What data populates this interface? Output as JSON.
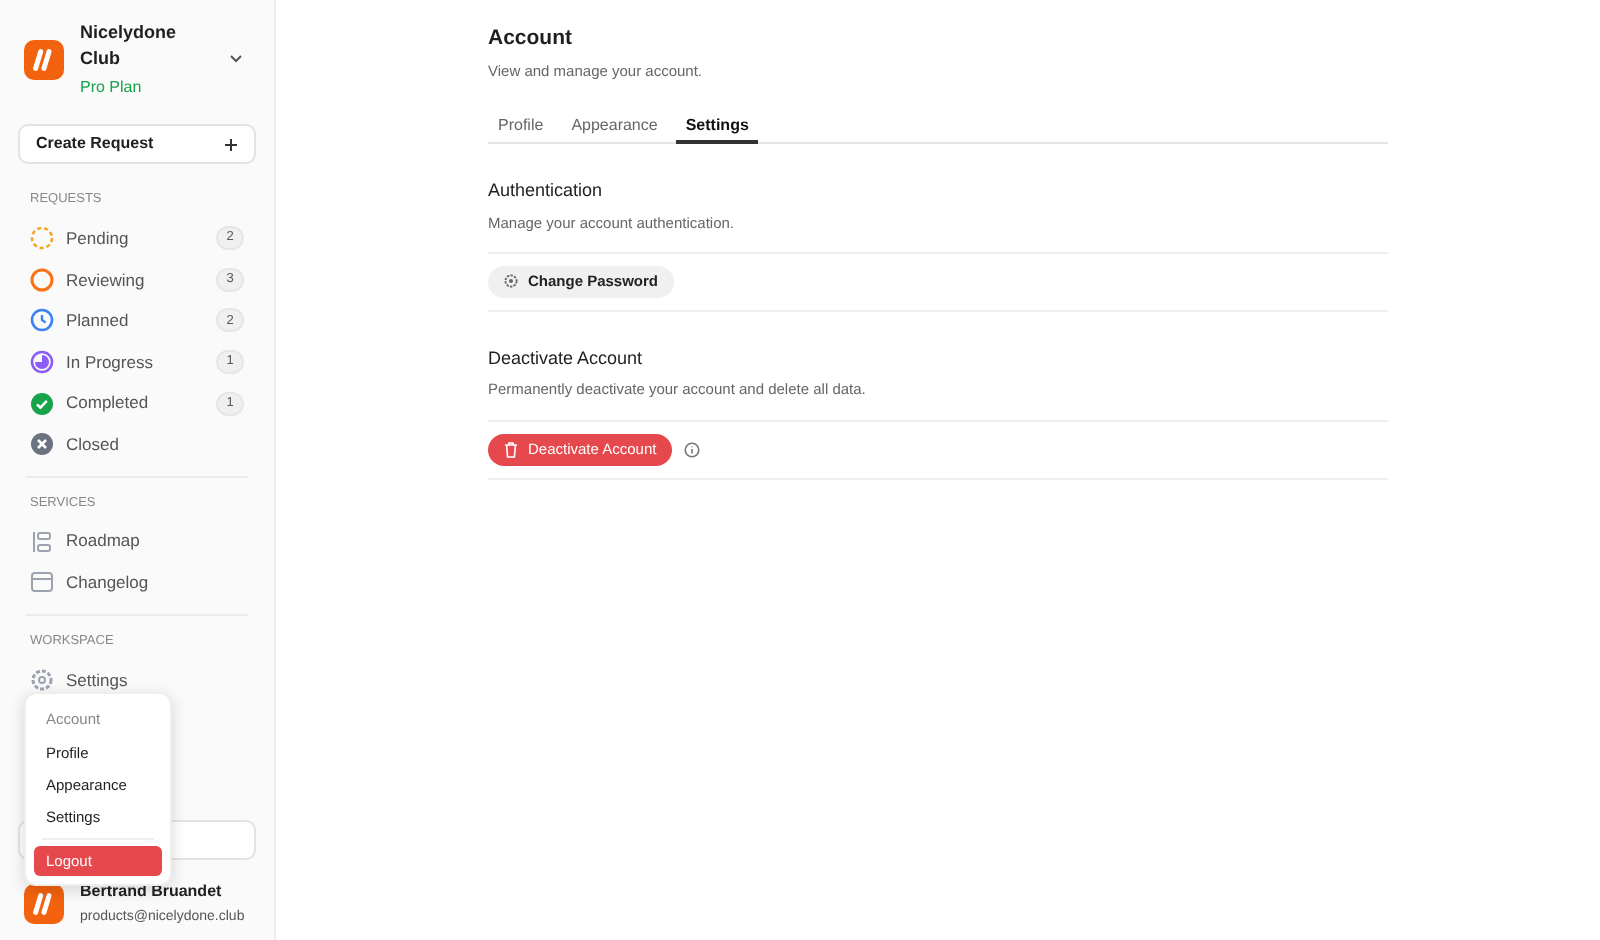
{
  "workspace": {
    "name": "Nicelydone Club",
    "plan": "Pro Plan"
  },
  "create_button": {
    "label": "Create Request"
  },
  "requests": {
    "heading": "REQUESTS",
    "items": [
      {
        "label": "Pending",
        "count": "2",
        "kind": "pending",
        "color": "#f5a524"
      },
      {
        "label": "Reviewing",
        "count": "3",
        "kind": "reviewing",
        "color": "#f97316"
      },
      {
        "label": "Planned",
        "count": "2",
        "kind": "planned",
        "color": "#3b82f6"
      },
      {
        "label": "In Progress",
        "count": "1",
        "kind": "progress",
        "color": "#8b5cf6"
      },
      {
        "label": "Completed",
        "count": "1",
        "kind": "completed",
        "color": "#16a34a"
      },
      {
        "label": "Closed",
        "kind": "closed",
        "color": "#6b7280"
      }
    ]
  },
  "services": {
    "heading": "SERVICES",
    "items": [
      {
        "label": "Roadmap",
        "kind": "roadmap"
      },
      {
        "label": "Changelog",
        "kind": "changelog"
      }
    ]
  },
  "workspace_section": {
    "heading": "WORKSPACE",
    "items": [
      {
        "label": "Settings",
        "kind": "settings"
      }
    ]
  },
  "account_menu": {
    "heading": "Account",
    "items": [
      "Profile",
      "Appearance",
      "Settings"
    ],
    "logout": "Logout"
  },
  "user": {
    "name": "Bertrand Bruandet",
    "email": "products@nicelydone.club"
  },
  "page": {
    "title": "Account",
    "subtitle": "View and manage your account.",
    "tabs": [
      {
        "label": "Profile",
        "selected": false
      },
      {
        "label": "Appearance",
        "selected": false
      },
      {
        "label": "Settings",
        "selected": true
      }
    ],
    "sections": [
      {
        "title": "Authentication",
        "description": "Manage your account authentication.",
        "button": "Change Password",
        "kind": "neutral"
      },
      {
        "title": "Deactivate Account",
        "description": "Permanently deactivate your account and delete all data.",
        "button": "Deactivate Account",
        "kind": "danger"
      }
    ]
  }
}
